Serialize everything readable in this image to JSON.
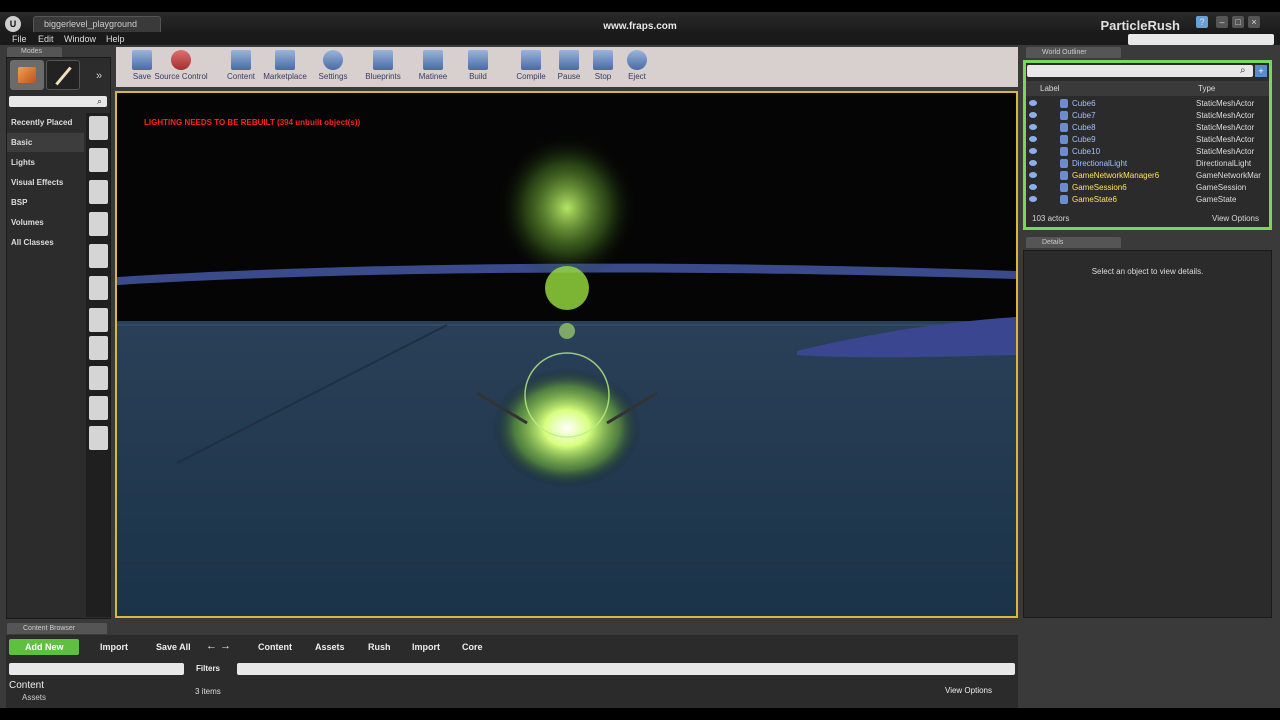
{
  "window": {
    "level_tab": "biggerlevel_playground",
    "watermark": "www.fraps.com",
    "project": "ParticleRush"
  },
  "menu": [
    "File",
    "Edit",
    "Window",
    "Help"
  ],
  "modes": {
    "tab": "Modes",
    "categories": [
      "Recently Placed",
      "Basic",
      "Lights",
      "Visual Effects",
      "BSP",
      "Volumes",
      "All Classes"
    ],
    "selected_category": "Basic"
  },
  "toolbar": {
    "buttons": [
      "Save",
      "Source Control",
      "Content",
      "Marketplace",
      "Settings",
      "Blueprints",
      "Matinee",
      "Build",
      "Compile",
      "Pause",
      "Stop",
      "Eject"
    ]
  },
  "viewport": {
    "warning": "LIGHTING NEEDS TO BE REBUILT (394 unbuilt object(s))"
  },
  "world_outliner": {
    "tab": "World Outliner",
    "columns": {
      "label": "Label",
      "type": "Type"
    },
    "rows": [
      {
        "label": "Cube6",
        "type": "StaticMeshActor",
        "color": "#9fc0ff"
      },
      {
        "label": "Cube7",
        "type": "StaticMeshActor",
        "color": "#9fc0ff"
      },
      {
        "label": "Cube8",
        "type": "StaticMeshActor",
        "color": "#9fc0ff"
      },
      {
        "label": "Cube9",
        "type": "StaticMeshActor",
        "color": "#9fc0ff"
      },
      {
        "label": "Cube10",
        "type": "StaticMeshActor",
        "color": "#9fc0ff"
      },
      {
        "label": "DirectionalLight",
        "type": "DirectionalLight",
        "color": "#9fc0ff"
      },
      {
        "label": "GameNetworkManager6",
        "type": "GameNetworkMar",
        "color": "#ffe066"
      },
      {
        "label": "GameSession6",
        "type": "GameSession",
        "color": "#ffe066"
      },
      {
        "label": "GameState6",
        "type": "GameState",
        "color": "#ffe066"
      }
    ],
    "actor_count": "103 actors",
    "view_options": "View Options"
  },
  "details": {
    "tab": "Details",
    "empty_message": "Select an object to view details."
  },
  "content_browser": {
    "tab": "Content Browser",
    "add_new": "Add New",
    "import": "Import",
    "save_all": "Save All",
    "breadcrumb": [
      "Content",
      "Assets",
      "Rush",
      "Import",
      "Core"
    ],
    "filters": "Filters",
    "folder_root": "Content",
    "folder_child": "Assets",
    "items_count": "3 items",
    "view_options": "View Options"
  },
  "colors": {
    "accent_green": "#79d85a",
    "viewport_border": "#d7b93a",
    "warning_red": "#ff2020"
  }
}
